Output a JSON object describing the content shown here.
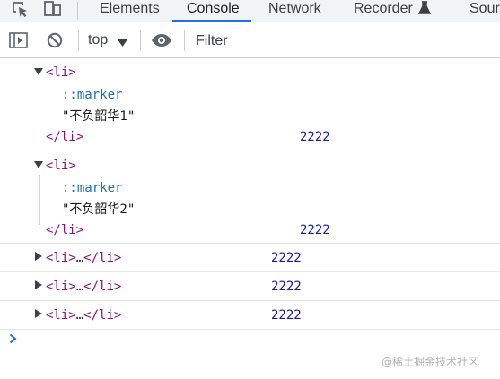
{
  "tabs": [
    "Elements",
    "Console",
    "Network",
    "Recorder",
    "Sources"
  ],
  "active_tab": "Console",
  "toolbar": {
    "context_label": "top",
    "filter_placeholder": "Filter"
  },
  "console": {
    "entries": [
      {
        "expanded": true,
        "open_tag": "<li>",
        "marker": "::marker",
        "text": "\"不负韶华1\"",
        "close_tag": "</li>",
        "value": "2222"
      },
      {
        "expanded": true,
        "open_tag": "<li>",
        "marker": "::marker",
        "text": "\"不负韶华2\"",
        "close_tag": "</li>",
        "value": "2222"
      },
      {
        "expanded": false,
        "open_tag": "<li>",
        "ellipsis": "…",
        "close_tag": "</li>",
        "value": "2222"
      },
      {
        "expanded": false,
        "open_tag": "<li>",
        "ellipsis": "…",
        "close_tag": "</li>",
        "value": "2222"
      },
      {
        "expanded": false,
        "open_tag": "<li>",
        "ellipsis": "…",
        "close_tag": "</li>",
        "value": "2222"
      }
    ]
  },
  "watermark": "@稀土掘金技术社区",
  "colors": {
    "tag": "#881280",
    "pseudo": "#1a6fb5",
    "number": "#1a1aa6",
    "accent": "#1a73e8"
  }
}
